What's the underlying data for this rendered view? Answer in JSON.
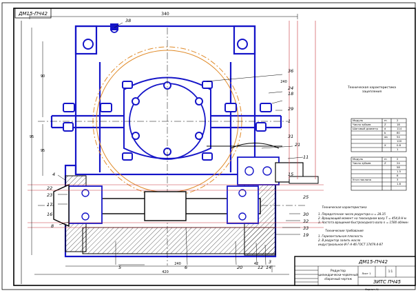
{
  "stamp": {
    "code": "ДМ15-ПЧ42"
  },
  "dims": {
    "top": "340",
    "left_a": "95",
    "left_b": "90",
    "left_c": "95",
    "bottom_a": "240",
    "bottom_b": "420",
    "bottom_c": "42",
    "right": "240"
  },
  "callouts": [
    "38",
    "36",
    "24",
    "18",
    "29",
    "21",
    "6",
    "30",
    "32",
    "33",
    "19",
    "20",
    "12",
    "14",
    "3",
    "11",
    "15",
    "25",
    "1",
    "31",
    "22",
    "23",
    "17",
    "16",
    "8",
    "4",
    "5"
  ],
  "tech_table": {
    "title": "Техническая характеристика",
    "subtitle": "зацепления",
    "header": [
      "Модуль",
      "m",
      "2"
    ],
    "rows": [
      [
        "Число зубьев",
        "Z",
        "18"
      ],
      [
        "Шаговый диаметр",
        "d",
        "114"
      ],
      [
        "",
        "b",
        "80"
      ],
      [
        "",
        "da",
        "54"
      ],
      [
        "",
        "",
        "120"
      ],
      [
        "",
        "X",
        "0.8"
      ],
      [
        "",
        "",
        "1"
      ]
    ],
    "rows2": [
      [
        "Модуль",
        "m",
        "2"
      ],
      [
        "Число зубьев",
        "Z",
        "24"
      ],
      [
        "",
        "",
        "58"
      ],
      [
        "",
        "",
        "1.5"
      ],
      [
        "",
        "",
        "8"
      ],
      [
        "Угол наклона",
        "",
        "3"
      ],
      [
        "",
        "",
        "1.8"
      ]
    ]
  },
  "notes": {
    "title1": "Техническая характеристика",
    "lines1": [
      "1. Передаточное число редуктора u = 28.35",
      "2. Вращающий момент на тихоходном валу Т = 454,8 Н·м",
      "3. Частота вращения быстроходного вала n = 1500 об/мин"
    ],
    "title2": "Технические требования",
    "lines2": [
      "1. Горизонтальная плоскость",
      "2. В редуктор залить масло",
      "индустриальное  И-Г-А-46  ГОСТ 17479.4-87"
    ]
  },
  "title_block": {
    "code": "ДМ15-ПЧ42",
    "doc_title": "Редуктор",
    "doc_sub1": "цилиндрически-червячный",
    "doc_sub2": "сборочный чертеж",
    "org": "ЗИТС ПЧ45",
    "scale": "1:1",
    "sheet": "Лист 1"
  },
  "format": "Формат А1"
}
